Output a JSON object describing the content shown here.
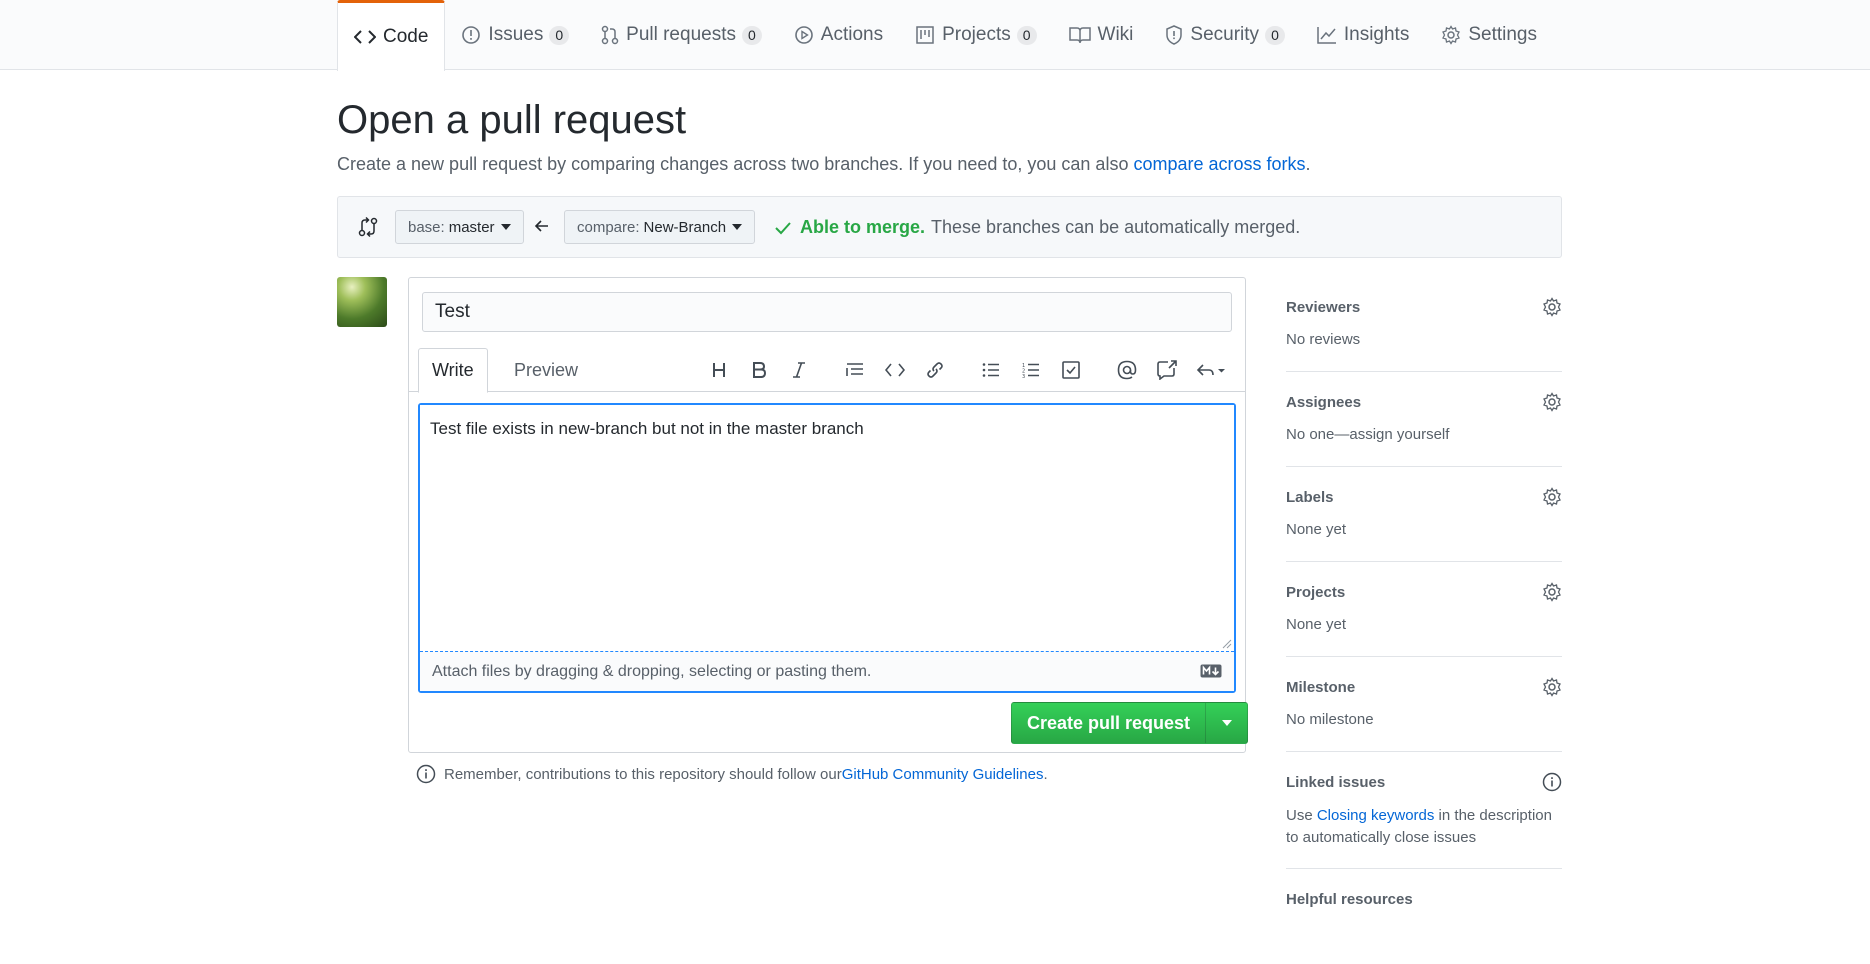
{
  "nav": {
    "tabs": [
      {
        "label": "Code",
        "count": null,
        "icon": "code-icon",
        "selected": true
      },
      {
        "label": "Issues",
        "count": "0",
        "icon": "issue-icon"
      },
      {
        "label": "Pull requests",
        "count": "0",
        "icon": "pull-request-icon"
      },
      {
        "label": "Actions",
        "count": null,
        "icon": "play-icon"
      },
      {
        "label": "Projects",
        "count": "0",
        "icon": "project-icon"
      },
      {
        "label": "Wiki",
        "count": null,
        "icon": "book-icon"
      },
      {
        "label": "Security",
        "count": "0",
        "icon": "shield-icon"
      },
      {
        "label": "Insights",
        "count": null,
        "icon": "graph-icon"
      },
      {
        "label": "Settings",
        "count": null,
        "icon": "gear-icon"
      }
    ],
    "accent": "#e36209"
  },
  "page": {
    "title": "Open a pull request",
    "subtitle_prefix": "Create a new pull request by comparing changes across two branches. If you need to, you can also ",
    "subtitle_link": "compare across forks",
    "subtitle_suffix": "."
  },
  "range": {
    "base_prefix": "base:",
    "base_branch": "master",
    "compare_prefix": "compare:",
    "compare_branch": "New-Branch",
    "merge_ok": "Able to merge.",
    "merge_text": "These branches can be automatically merged.",
    "ok_color": "#28a745"
  },
  "form": {
    "title_value": "Test",
    "tab_write": "Write",
    "tab_preview": "Preview",
    "toolbar_icons": [
      "header-icon",
      "bold-icon",
      "italic-icon",
      "quote-icon",
      "code-icon",
      "link-icon",
      "bullet-list-icon",
      "numbered-list-icon",
      "task-list-icon",
      "mention-icon",
      "reference-icon",
      "reply-icon"
    ],
    "body_value": "Test file exists in new-branch but not in the master branch",
    "attach_text": "Attach files by dragging & dropping, selecting or pasting them.",
    "create_label": "Create pull request"
  },
  "guidelines": {
    "prefix": "Remember, contributions to this repository should follow our ",
    "link": "GitHub Community Guidelines",
    "suffix": "."
  },
  "sidebar": {
    "reviewers": {
      "label": "Reviewers",
      "value": "No reviews"
    },
    "assignees": {
      "label": "Assignees",
      "value": "No one—assign yourself"
    },
    "labels": {
      "label": "Labels",
      "value": "None yet"
    },
    "projects": {
      "label": "Projects",
      "value": "None yet"
    },
    "milestone": {
      "label": "Milestone",
      "value": "No milestone"
    },
    "linked": {
      "label": "Linked issues",
      "pre": "Use ",
      "link": "Closing keywords",
      "post": " in the description to automatically close issues"
    },
    "helpful": {
      "label": "Helpful resources"
    }
  }
}
